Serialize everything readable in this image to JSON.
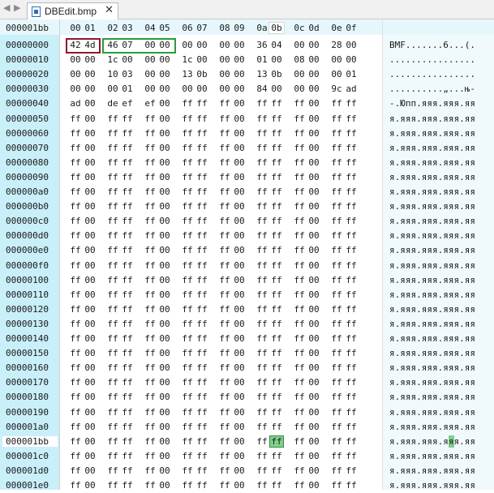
{
  "tab": {
    "title": "DBEdit.bmp"
  },
  "header": {
    "address": "000001bb",
    "columns": [
      "00",
      "01",
      "02",
      "03",
      "04",
      "05",
      "06",
      "07",
      "08",
      "09",
      "0a",
      "0b",
      "0c",
      "0d",
      "0e",
      "0f"
    ],
    "current_column": "0b"
  },
  "rows": [
    {
      "address": "00000000",
      "bytes": [
        "42",
        "4d",
        "46",
        "07",
        "00",
        "00",
        "00",
        "00",
        "00",
        "00",
        "36",
        "04",
        "00",
        "00",
        "28",
        "00"
      ],
      "ascii": "BMF.......6...(."
    },
    {
      "address": "00000010",
      "bytes": [
        "00",
        "00",
        "1c",
        "00",
        "00",
        "00",
        "1c",
        "00",
        "00",
        "00",
        "01",
        "00",
        "08",
        "00",
        "00",
        "00"
      ],
      "ascii": "................"
    },
    {
      "address": "00000020",
      "bytes": [
        "00",
        "00",
        "10",
        "03",
        "00",
        "00",
        "13",
        "0b",
        "00",
        "00",
        "13",
        "0b",
        "00",
        "00",
        "00",
        "01"
      ],
      "ascii": "................"
    },
    {
      "address": "00000030",
      "bytes": [
        "00",
        "00",
        "00",
        "01",
        "00",
        "00",
        "00",
        "00",
        "00",
        "00",
        "84",
        "00",
        "00",
        "00",
        "9c",
        "ad"
      ],
      "ascii": "..........„...њ-"
    },
    {
      "address": "00000040",
      "bytes": [
        "ad",
        "00",
        "de",
        "ef",
        "ef",
        "00",
        "ff",
        "ff",
        "ff",
        "00",
        "ff",
        "ff",
        "ff",
        "00",
        "ff",
        "ff"
      ],
      "ascii": "-.Юпп.яяя.яяя.яя"
    },
    {
      "address": "00000050",
      "bytes": [
        "ff",
        "00",
        "ff",
        "ff",
        "ff",
        "00",
        "ff",
        "ff",
        "ff",
        "00",
        "ff",
        "ff",
        "ff",
        "00",
        "ff",
        "ff"
      ],
      "ascii": "я.яяя.яяя.яяя.яя"
    },
    {
      "address": "00000060",
      "bytes": [
        "ff",
        "00",
        "ff",
        "ff",
        "ff",
        "00",
        "ff",
        "ff",
        "ff",
        "00",
        "ff",
        "ff",
        "ff",
        "00",
        "ff",
        "ff"
      ],
      "ascii": "я.яяя.яяя.яяя.яя"
    },
    {
      "address": "00000070",
      "bytes": [
        "ff",
        "00",
        "ff",
        "ff",
        "ff",
        "00",
        "ff",
        "ff",
        "ff",
        "00",
        "ff",
        "ff",
        "ff",
        "00",
        "ff",
        "ff"
      ],
      "ascii": "я.яяя.яяя.яяя.яя"
    },
    {
      "address": "00000080",
      "bytes": [
        "ff",
        "00",
        "ff",
        "ff",
        "ff",
        "00",
        "ff",
        "ff",
        "ff",
        "00",
        "ff",
        "ff",
        "ff",
        "00",
        "ff",
        "ff"
      ],
      "ascii": "я.яяя.яяя.яяя.яя"
    },
    {
      "address": "00000090",
      "bytes": [
        "ff",
        "00",
        "ff",
        "ff",
        "ff",
        "00",
        "ff",
        "ff",
        "ff",
        "00",
        "ff",
        "ff",
        "ff",
        "00",
        "ff",
        "ff"
      ],
      "ascii": "я.яяя.яяя.яяя.яя"
    },
    {
      "address": "000000a0",
      "bytes": [
        "ff",
        "00",
        "ff",
        "ff",
        "ff",
        "00",
        "ff",
        "ff",
        "ff",
        "00",
        "ff",
        "ff",
        "ff",
        "00",
        "ff",
        "ff"
      ],
      "ascii": "я.яяя.яяя.яяя.яя"
    },
    {
      "address": "000000b0",
      "bytes": [
        "ff",
        "00",
        "ff",
        "ff",
        "ff",
        "00",
        "ff",
        "ff",
        "ff",
        "00",
        "ff",
        "ff",
        "ff",
        "00",
        "ff",
        "ff"
      ],
      "ascii": "я.яяя.яяя.яяя.яя"
    },
    {
      "address": "000000c0",
      "bytes": [
        "ff",
        "00",
        "ff",
        "ff",
        "ff",
        "00",
        "ff",
        "ff",
        "ff",
        "00",
        "ff",
        "ff",
        "ff",
        "00",
        "ff",
        "ff"
      ],
      "ascii": "я.яяя.яяя.яяя.яя"
    },
    {
      "address": "000000d0",
      "bytes": [
        "ff",
        "00",
        "ff",
        "ff",
        "ff",
        "00",
        "ff",
        "ff",
        "ff",
        "00",
        "ff",
        "ff",
        "ff",
        "00",
        "ff",
        "ff"
      ],
      "ascii": "я.яяя.яяя.яяя.яя"
    },
    {
      "address": "000000e0",
      "bytes": [
        "ff",
        "00",
        "ff",
        "ff",
        "ff",
        "00",
        "ff",
        "ff",
        "ff",
        "00",
        "ff",
        "ff",
        "ff",
        "00",
        "ff",
        "ff"
      ],
      "ascii": "я.яяя.яяя.яяя.яя"
    },
    {
      "address": "000000f0",
      "bytes": [
        "ff",
        "00",
        "ff",
        "ff",
        "ff",
        "00",
        "ff",
        "ff",
        "ff",
        "00",
        "ff",
        "ff",
        "ff",
        "00",
        "ff",
        "ff"
      ],
      "ascii": "я.яяя.яяя.яяя.яя"
    },
    {
      "address": "00000100",
      "bytes": [
        "ff",
        "00",
        "ff",
        "ff",
        "ff",
        "00",
        "ff",
        "ff",
        "ff",
        "00",
        "ff",
        "ff",
        "ff",
        "00",
        "ff",
        "ff"
      ],
      "ascii": "я.яяя.яяя.яяя.яя"
    },
    {
      "address": "00000110",
      "bytes": [
        "ff",
        "00",
        "ff",
        "ff",
        "ff",
        "00",
        "ff",
        "ff",
        "ff",
        "00",
        "ff",
        "ff",
        "ff",
        "00",
        "ff",
        "ff"
      ],
      "ascii": "я.яяя.яяя.яяя.яя"
    },
    {
      "address": "00000120",
      "bytes": [
        "ff",
        "00",
        "ff",
        "ff",
        "ff",
        "00",
        "ff",
        "ff",
        "ff",
        "00",
        "ff",
        "ff",
        "ff",
        "00",
        "ff",
        "ff"
      ],
      "ascii": "я.яяя.яяя.яяя.яя"
    },
    {
      "address": "00000130",
      "bytes": [
        "ff",
        "00",
        "ff",
        "ff",
        "ff",
        "00",
        "ff",
        "ff",
        "ff",
        "00",
        "ff",
        "ff",
        "ff",
        "00",
        "ff",
        "ff"
      ],
      "ascii": "я.яяя.яяя.яяя.яя"
    },
    {
      "address": "00000140",
      "bytes": [
        "ff",
        "00",
        "ff",
        "ff",
        "ff",
        "00",
        "ff",
        "ff",
        "ff",
        "00",
        "ff",
        "ff",
        "ff",
        "00",
        "ff",
        "ff"
      ],
      "ascii": "я.яяя.яяя.яяя.яя"
    },
    {
      "address": "00000150",
      "bytes": [
        "ff",
        "00",
        "ff",
        "ff",
        "ff",
        "00",
        "ff",
        "ff",
        "ff",
        "00",
        "ff",
        "ff",
        "ff",
        "00",
        "ff",
        "ff"
      ],
      "ascii": "я.яяя.яяя.яяя.яя"
    },
    {
      "address": "00000160",
      "bytes": [
        "ff",
        "00",
        "ff",
        "ff",
        "ff",
        "00",
        "ff",
        "ff",
        "ff",
        "00",
        "ff",
        "ff",
        "ff",
        "00",
        "ff",
        "ff"
      ],
      "ascii": "я.яяя.яяя.яяя.яя"
    },
    {
      "address": "00000170",
      "bytes": [
        "ff",
        "00",
        "ff",
        "ff",
        "ff",
        "00",
        "ff",
        "ff",
        "ff",
        "00",
        "ff",
        "ff",
        "ff",
        "00",
        "ff",
        "ff"
      ],
      "ascii": "я.яяя.яяя.яяя.яя"
    },
    {
      "address": "00000180",
      "bytes": [
        "ff",
        "00",
        "ff",
        "ff",
        "ff",
        "00",
        "ff",
        "ff",
        "ff",
        "00",
        "ff",
        "ff",
        "ff",
        "00",
        "ff",
        "ff"
      ],
      "ascii": "я.яяя.яяя.яяя.яя"
    },
    {
      "address": "00000190",
      "bytes": [
        "ff",
        "00",
        "ff",
        "ff",
        "ff",
        "00",
        "ff",
        "ff",
        "ff",
        "00",
        "ff",
        "ff",
        "ff",
        "00",
        "ff",
        "ff"
      ],
      "ascii": "я.яяя.яяя.яяя.яя"
    },
    {
      "address": "000001a0",
      "bytes": [
        "ff",
        "00",
        "ff",
        "ff",
        "ff",
        "00",
        "ff",
        "ff",
        "ff",
        "00",
        "ff",
        "ff",
        "ff",
        "00",
        "ff",
        "ff"
      ],
      "ascii": "я.яяя.яяя.яяя.яя"
    },
    {
      "address": "000001bb",
      "bytes": [
        "ff",
        "00",
        "ff",
        "ff",
        "ff",
        "00",
        "ff",
        "ff",
        "ff",
        "00",
        "ff",
        "ff",
        "ff",
        "00",
        "ff",
        "ff"
      ],
      "ascii": "я.яяя.яяя.яяя.яя",
      "current": true,
      "highlight_index": 11
    },
    {
      "address": "000001c0",
      "bytes": [
        "ff",
        "00",
        "ff",
        "ff",
        "ff",
        "00",
        "ff",
        "ff",
        "ff",
        "00",
        "ff",
        "ff",
        "ff",
        "00",
        "ff",
        "ff"
      ],
      "ascii": "я.яяя.яяя.яяя.яя"
    },
    {
      "address": "000001d0",
      "bytes": [
        "ff",
        "00",
        "ff",
        "ff",
        "ff",
        "00",
        "ff",
        "ff",
        "ff",
        "00",
        "ff",
        "ff",
        "ff",
        "00",
        "ff",
        "ff"
      ],
      "ascii": "я.яяя.яяя.яяя.яя"
    },
    {
      "address": "000001e0",
      "bytes": [
        "ff",
        "00",
        "ff",
        "ff",
        "ff",
        "00",
        "ff",
        "ff",
        "ff",
        "00",
        "ff",
        "ff",
        "ff",
        "00",
        "ff",
        "ff"
      ],
      "ascii": "я.яяя.яяя.яяя.яя"
    }
  ],
  "colors": {
    "address_column": "#c9eff9",
    "selection": "#7fcf8a",
    "signature_box": "#8b1a2b",
    "filesize_box": "#2e9a3e"
  },
  "icons": {
    "file": "bitmap-file-icon",
    "close": "close-icon",
    "scroll_left": "triangle-left-icon",
    "scroll_right": "triangle-right-icon"
  }
}
